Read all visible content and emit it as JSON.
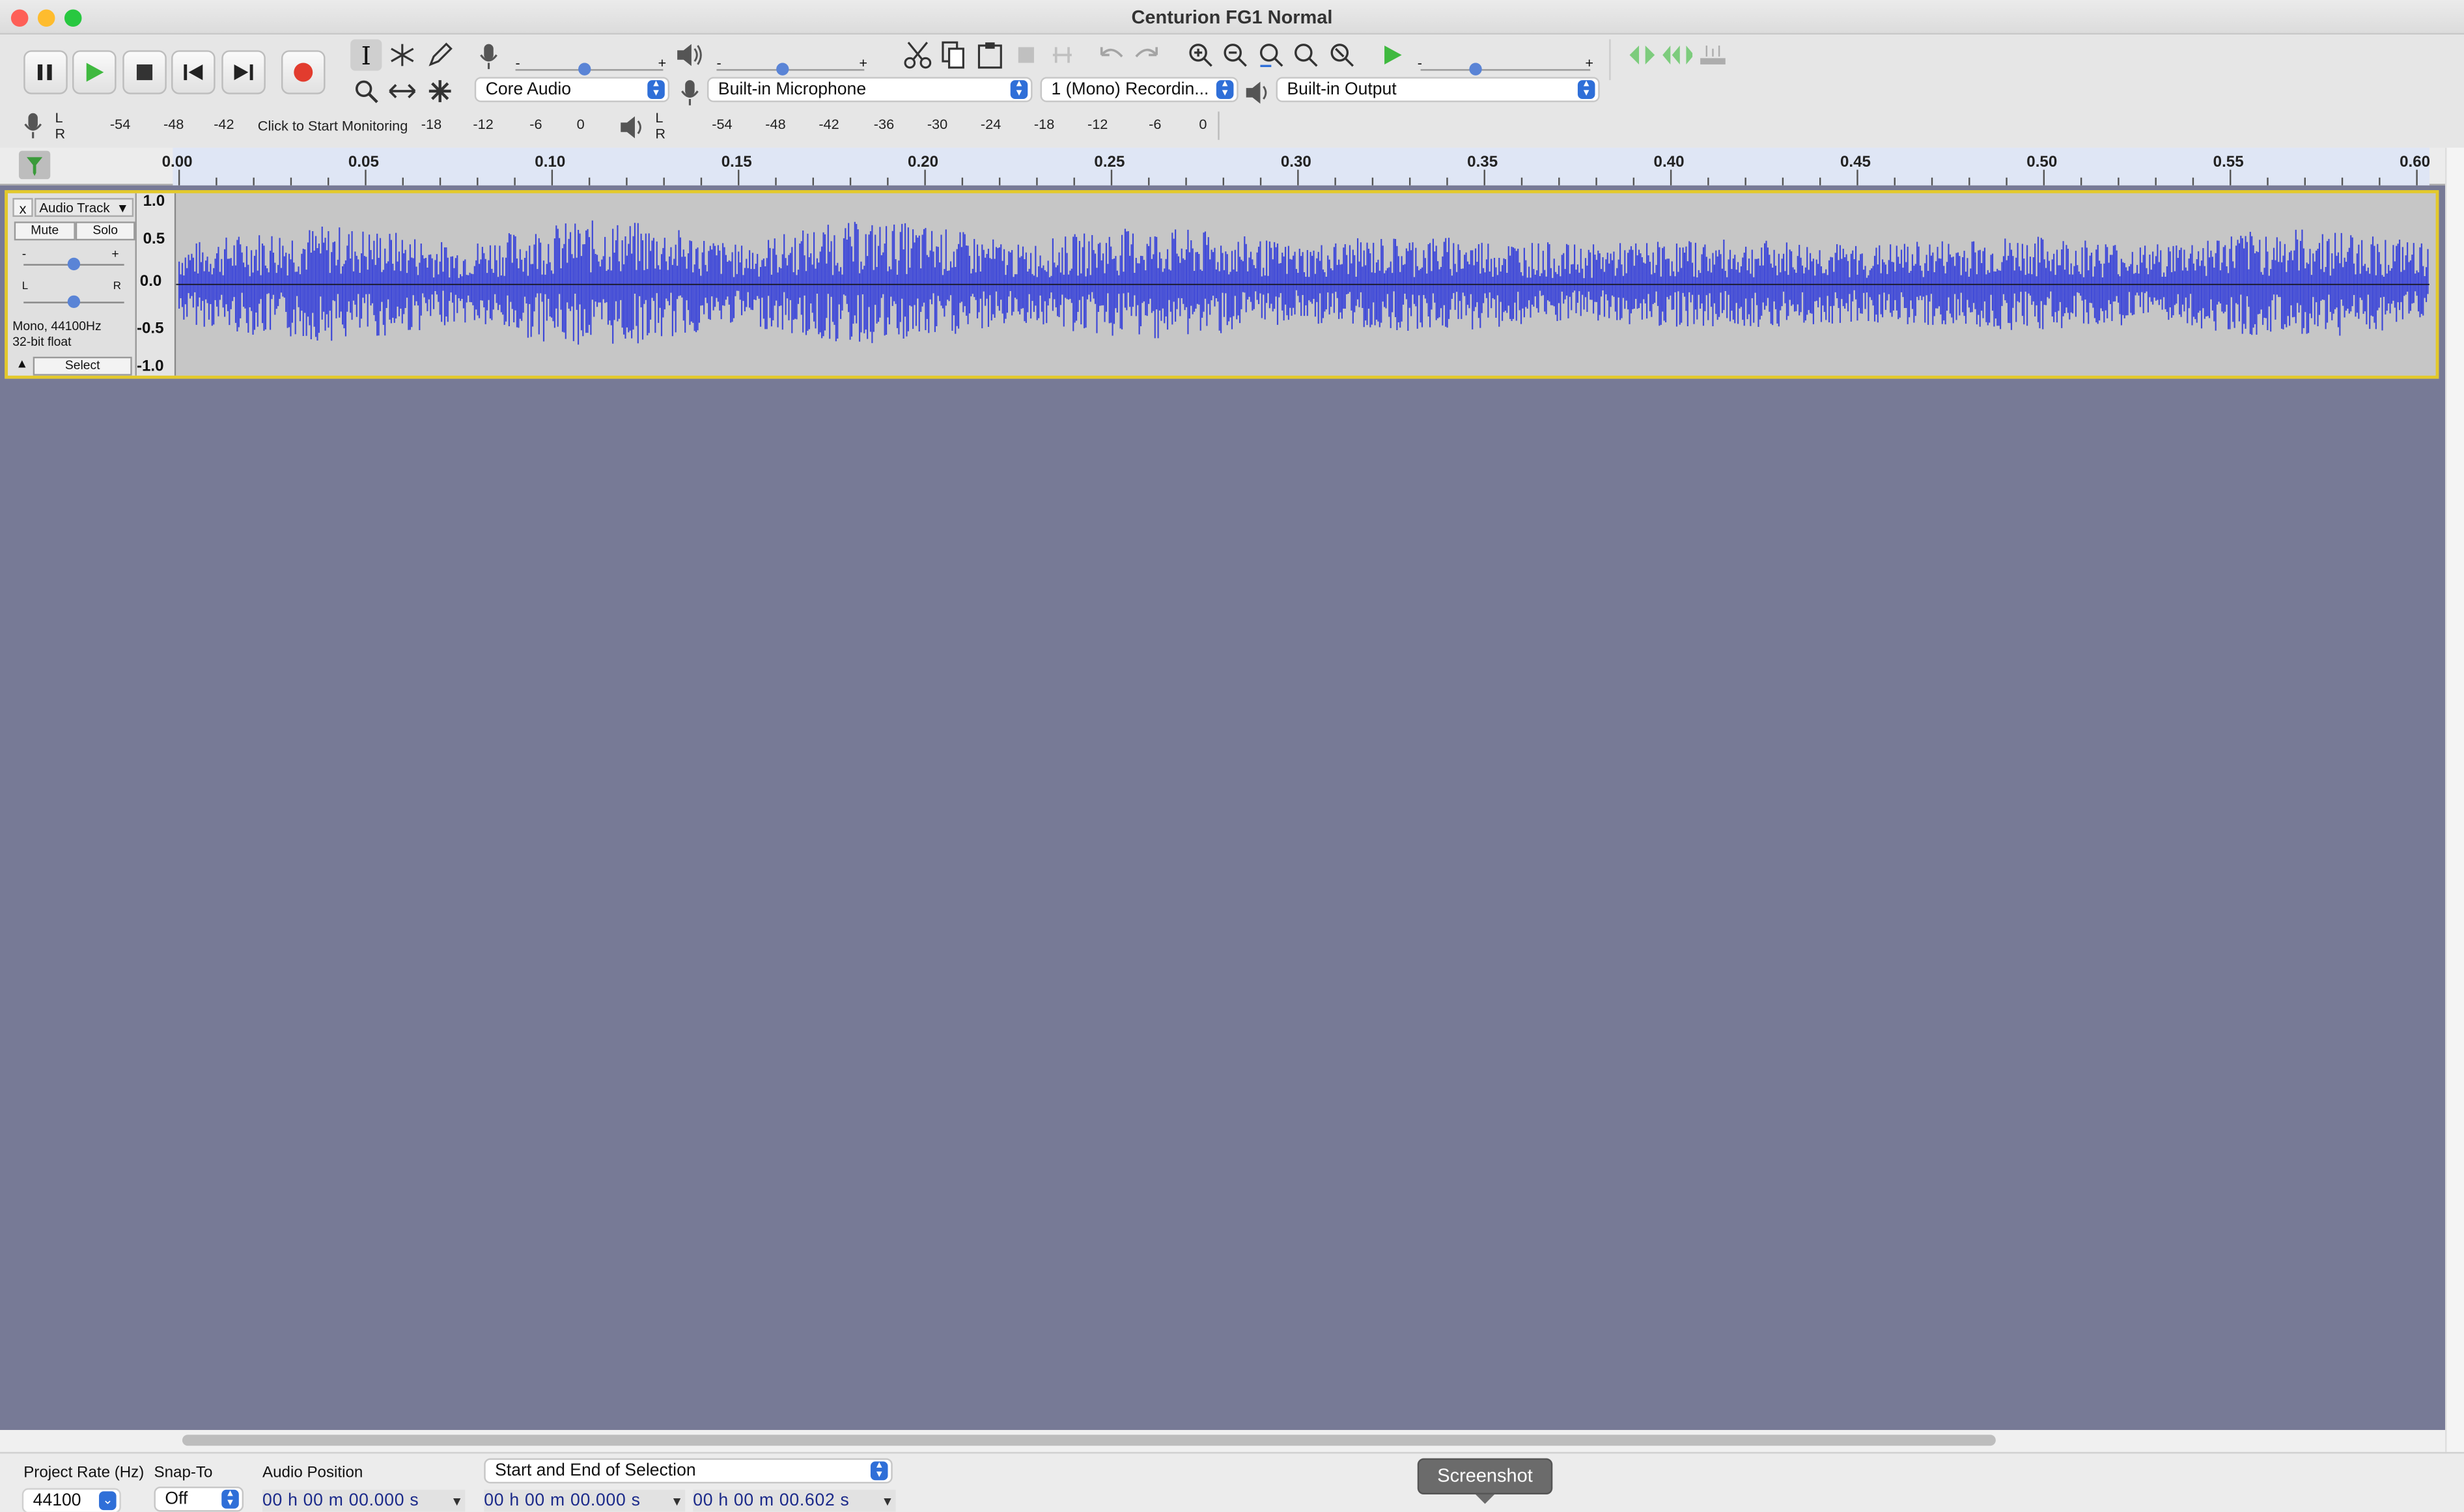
{
  "window": {
    "title": "Centurion FG1 Normal"
  },
  "transport": {
    "pause": "pause",
    "play": "play",
    "stop": "stop",
    "skip_start": "skip-start",
    "skip_end": "skip-end",
    "record": "record"
  },
  "device": {
    "host": "Core Audio",
    "input": "Built-in Microphone",
    "channels": "1 (Mono) Recordin...",
    "output": "Built-in Output"
  },
  "meters": {
    "record_ticks": [
      "-54",
      "-48",
      "-42",
      "-18",
      "-12",
      "-6",
      "0"
    ],
    "monitor_text": "Click to Start Monitoring",
    "play_ticks": [
      "-54",
      "-48",
      "-42",
      "-36",
      "-30",
      "-24",
      "-18",
      "-12",
      "-6",
      "0"
    ],
    "lr": [
      "L",
      "R"
    ]
  },
  "ruler": {
    "ticks": [
      "0.00",
      "0.05",
      "0.10",
      "0.15",
      "0.20",
      "0.25",
      "0.30",
      "0.35",
      "0.40",
      "0.45",
      "0.50",
      "0.55",
      "0.60"
    ]
  },
  "track": {
    "name": "Audio Track",
    "mute": "Mute",
    "solo": "Solo",
    "info_line1": "Mono, 44100Hz",
    "info_line2": "32-bit float",
    "select": "Select",
    "gain_minus": "-",
    "gain_plus": "+",
    "pan_l": "L",
    "pan_r": "R",
    "close": "x",
    "scale": [
      "1.0",
      "0.5",
      "0.0",
      "-0.5",
      "-1.0"
    ]
  },
  "status": {
    "project_rate_label": "Project Rate (Hz)",
    "project_rate": "44100",
    "snap_label": "Snap-To",
    "snap_value": "Off",
    "audio_position_label": "Audio Position",
    "selection_label": "Start and End of Selection",
    "audio_position": "00 h 00 m 00.000 s",
    "sel_start": "00 h 00 m 00.000 s",
    "sel_end": "00 h 00 m 00.602 s"
  },
  "tooltip": "Screenshot",
  "colors": {
    "waveform": "#3d47d8",
    "track_bg": "#777a96",
    "selection_border": "#e3c92b"
  }
}
